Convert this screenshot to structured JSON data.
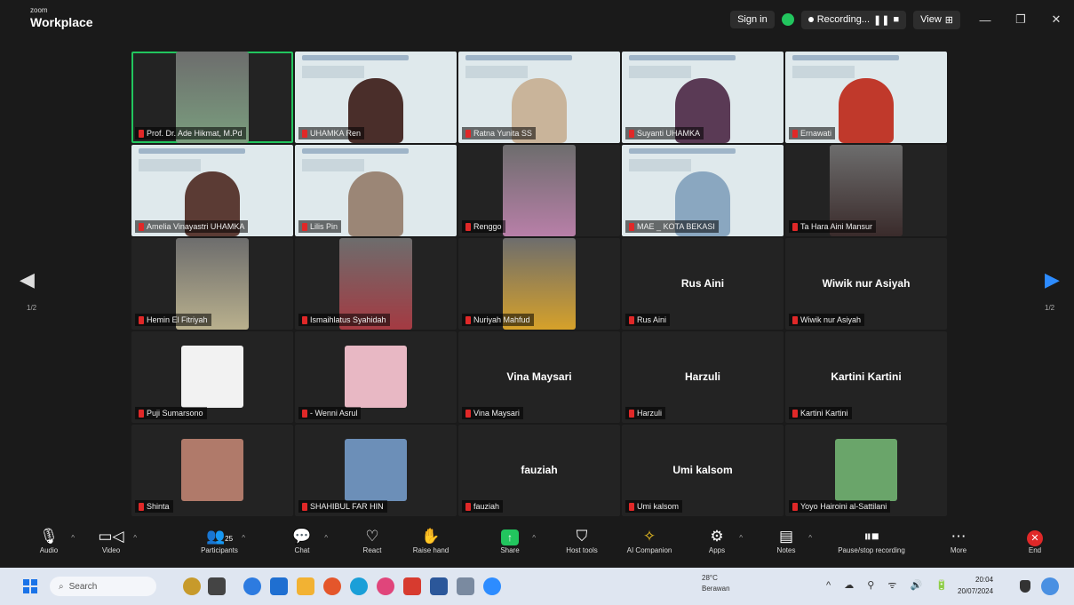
{
  "app": {
    "brand_small": "zoom",
    "brand": "Workplace"
  },
  "titlebar": {
    "sign_in": "Sign in",
    "recording": "Recording...",
    "view": "View"
  },
  "pager": {
    "left": "1/2",
    "right": "1/2"
  },
  "participants": [
    {
      "name": "Prof. Dr. Ade Hikmat, M.Pd",
      "kind": "video",
      "active": true,
      "color": "#7a9e7e"
    },
    {
      "name": "UHAMKA Ren",
      "kind": "slide",
      "color": "#4a2e2a"
    },
    {
      "name": "Ratna Yunita SS",
      "kind": "slide",
      "color": "#c9b49a"
    },
    {
      "name": "Suyanti UHAMKA",
      "kind": "slide",
      "color": "#5a3a55"
    },
    {
      "name": "Ernawati",
      "kind": "slide",
      "color": "#c0392b"
    },
    {
      "name": "Amelia Vinayastri UHAMKA",
      "kind": "slide",
      "color": "#5b3b34"
    },
    {
      "name": "Lilis Pin",
      "kind": "slide",
      "color": "#9b8676"
    },
    {
      "name": "Renggo",
      "kind": "video",
      "color": "#b87fa8"
    },
    {
      "name": "MAE _ KOTA BEKASI",
      "kind": "slide",
      "color": "#8aa7c0"
    },
    {
      "name": "Ta Hara Aini Mansur",
      "kind": "video",
      "color": "#3a2b2b"
    },
    {
      "name": "Hemin El Fitriyah",
      "kind": "video",
      "color": "#b9b08d"
    },
    {
      "name": "Ismaihlatus Syahidah",
      "kind": "video",
      "color": "#a43a42"
    },
    {
      "name": "Nuriyah Mahfud",
      "kind": "video",
      "color": "#d6a12a"
    },
    {
      "name": "Rus Aini",
      "kind": "name",
      "display": "Rus Aini"
    },
    {
      "name": "Wiwik nur Asiyah",
      "kind": "name",
      "display": "Wiwik nur Asiyah"
    },
    {
      "name": "Puji Sumarsono",
      "kind": "avatar",
      "color": "#f2f2f2"
    },
    {
      "name": "- Wenni Asrul",
      "kind": "avatar",
      "color": "#e8b8c4"
    },
    {
      "name": "Vina Maysari",
      "kind": "name",
      "display": "Vina Maysari"
    },
    {
      "name": "Harzuli",
      "kind": "name",
      "display": "Harzuli"
    },
    {
      "name": "Kartini Kartini",
      "kind": "name",
      "display": "Kartini Kartini"
    },
    {
      "name": "Shinta",
      "kind": "avatar",
      "color": "#b07a6a"
    },
    {
      "name": "SHAHIBUL FAR HIN",
      "kind": "avatar",
      "color": "#6c8fb8"
    },
    {
      "name": "fauziah",
      "kind": "name",
      "display": "fauziah"
    },
    {
      "name": "Umi kalsom",
      "kind": "name",
      "display": "Umi kalsom"
    },
    {
      "name": "Yoyo Hairoini al-Sattilani",
      "kind": "avatar",
      "color": "#6aa56a"
    }
  ],
  "toolbar": {
    "audio": "Audio",
    "video": "Video",
    "participants": "Participants",
    "participants_count": "25",
    "chat": "Chat",
    "react": "React",
    "raise_hand": "Raise hand",
    "share": "Share",
    "host_tools": "Host tools",
    "ai_companion": "AI Companion",
    "apps": "Apps",
    "notes": "Notes",
    "pause_stop": "Pause/stop recording",
    "more": "More",
    "end": "End"
  },
  "taskbar": {
    "search": "Search",
    "temp": "28°C",
    "weather": "Berawan",
    "time": "20:04",
    "date": "20/07/2024"
  }
}
